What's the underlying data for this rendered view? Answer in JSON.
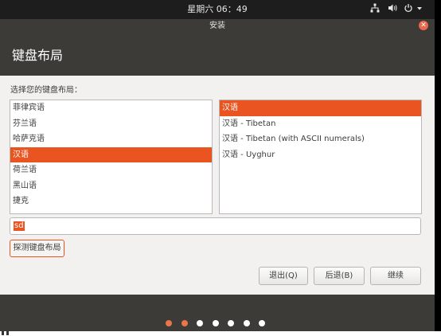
{
  "topbar": {
    "clock": "星期六 06：49",
    "network_icon": "network-icon",
    "volume_icon": "volume-icon",
    "power_icon": "power-icon",
    "menu_icon": "chevron-down-icon"
  },
  "window": {
    "title": "安装",
    "close_icon": "close-icon"
  },
  "header": {
    "title": "键盘布局"
  },
  "main": {
    "prompt": "选择您的键盘布局：",
    "layouts": [
      {
        "label": "菲律宾语",
        "selected": false
      },
      {
        "label": "芬兰语",
        "selected": false
      },
      {
        "label": "哈萨克语",
        "selected": false
      },
      {
        "label": "汉语",
        "selected": true
      },
      {
        "label": "荷兰语",
        "selected": false
      },
      {
        "label": "黑山语",
        "selected": false
      },
      {
        "label": "捷克",
        "selected": false
      }
    ],
    "variants": [
      {
        "label": "汉语",
        "selected": true
      },
      {
        "label": "汉语 - Tibetan",
        "selected": false
      },
      {
        "label": "汉语 - Tibetan (with ASCII numerals)",
        "selected": false
      },
      {
        "label": "汉语 - Uyghur",
        "selected": false
      }
    ],
    "test_input_value": "sd",
    "detect_button": "探测键盘布局",
    "quit_button": "退出(Q)",
    "back_button": "后退(B)",
    "continue_button": "继续"
  },
  "progress": {
    "total_steps": 7,
    "completed_steps": 2
  },
  "colors": {
    "accent": "#e95420",
    "dot_done": "#e9754a",
    "dot_todo": "#ffffff",
    "chrome": "#3c3b37",
    "panel": "#1d1d1d"
  }
}
